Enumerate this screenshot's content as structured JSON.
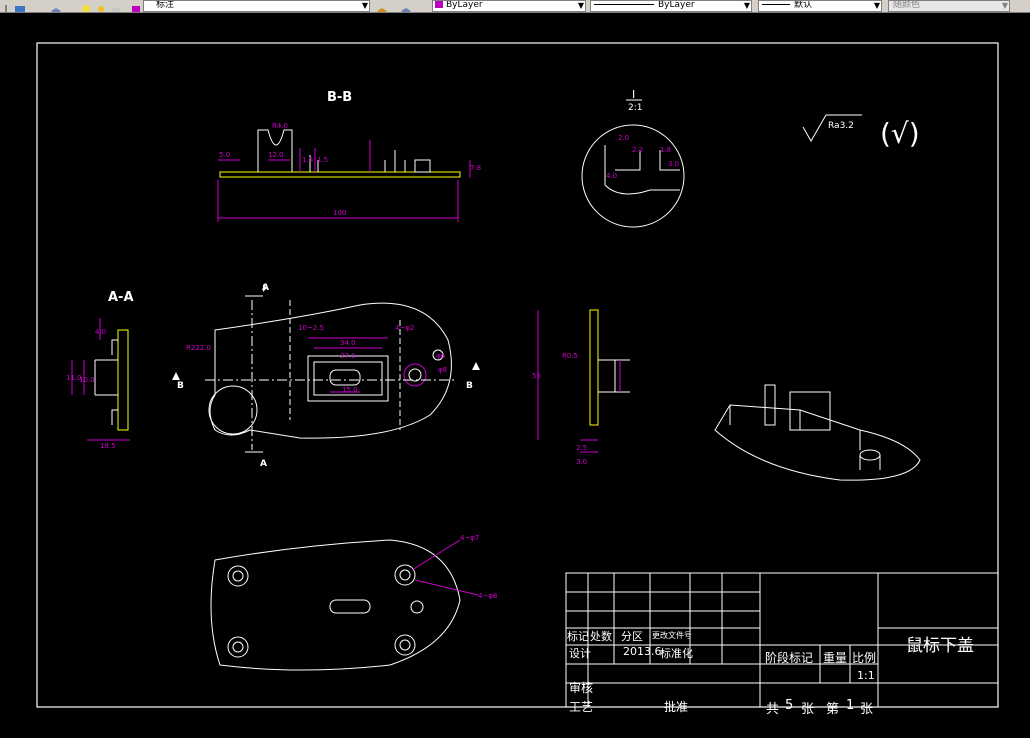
{
  "toolbar": {
    "dimstyle_value": "标注",
    "layer_color_value": "ByLayer",
    "linetype_value": "ByLayer",
    "lineweight_value": "默认",
    "plotstyle_value": "随颜色"
  },
  "drawing": {
    "section_bb": "B-B",
    "section_aa": "A-A",
    "detail_label": "I",
    "detail_scale": "2:1",
    "roughness": "Ra3.2",
    "roughness_check": "(√)",
    "cut_marks": [
      "A",
      "A",
      "B",
      "B"
    ],
    "dims": {
      "bb_overall": "100",
      "bb_a": "5.0",
      "bb_b": "12.0",
      "bb_c": "1.5",
      "bb_d": "1.5",
      "bb_e": "7.8",
      "bb_f": "R4.0",
      "aa_a": "4.0",
      "aa_b": "11.0",
      "aa_c": "10.0",
      "aa_d": "18.5",
      "plan_a": "34.0",
      "plan_b": "27.0",
      "plan_c": "15.0",
      "plan_d": "10~2.5",
      "plan_e": "4~φ2",
      "plan_f": "R222.0",
      "plan_g": "φ6",
      "plan_h": "φ8",
      "side_a": "55",
      "side_b": "R0.5",
      "side_c": "2.5",
      "side_d": "3.0",
      "det_a": "2.0",
      "det_b": "2.2",
      "det_c": "1.8",
      "det_d": "3.0",
      "det_e": "4.0",
      "bottom_a": "4~φ7",
      "bottom_b": "4~φ8"
    }
  },
  "title_block": {
    "part_name": "鼠标下盖",
    "biaoji": "标记",
    "chushu": "处数",
    "fenqu": "分区",
    "gengwen": "更改文件号",
    "sheji": "设计",
    "date": "2013.6",
    "biaozhunhua": "标准化",
    "jieduan": "阶段标记",
    "zhongliang": "重量",
    "bili": "比例",
    "scale": "1:1",
    "shenhe": "审核",
    "gongyi": "工艺",
    "pizhun": "批准",
    "gong": "共",
    "total_sheets": "5",
    "zhang1": "张",
    "di": "第",
    "sheet_no": "1",
    "zhang2": "张"
  }
}
